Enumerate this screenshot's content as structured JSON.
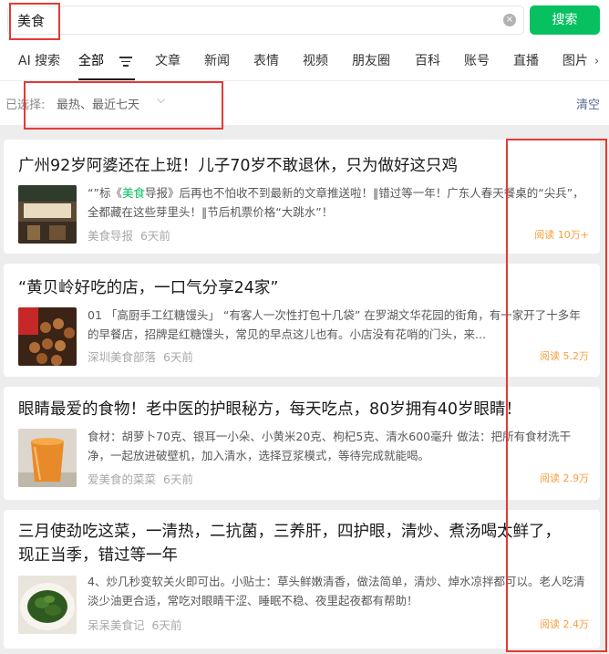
{
  "search": {
    "query": "美食",
    "clear_icon": "×",
    "button_label": "搜索"
  },
  "tabs": [
    "AI 搜索",
    "全部",
    "文章",
    "新闻",
    "表情",
    "视频",
    "朋友圈",
    "百科",
    "账号",
    "直播",
    "图片"
  ],
  "tab_more_icon": "›",
  "filter": {
    "label": "已选择:",
    "value": "最热、最近七天",
    "chevron": "⌵",
    "clear_label": "清空"
  },
  "colors": {
    "accent": "#07c160",
    "read_color": "#fa9d3b",
    "annotation_red": "#e53935"
  },
  "results": [
    {
      "title": "广州92岁阿婆还在上班！儿子70岁不敢退休，只为做好这只鸡",
      "snippet_pre": "“”标《",
      "snippet_hl": "美食",
      "snippet_post": "导报》后再也不怕收不到最新的文章推送啦！‖错过等一年！广东人春天餐桌的“尖兵”，全都藏在这些芽里头！‖节后机票价格“大跳水”！",
      "source": "美食导报",
      "time": "6天前",
      "reads": "阅读 10万+"
    },
    {
      "title": "“黄贝岭好吃的店，一口气分享24家”",
      "snippet_pre": "01 「高厨手工红糖馒头」 “有客人一次性打包十几袋” 在罗湖文华花园的街角，有一家开了十多年的早餐店，招牌是红糖馒头，常见的早点这儿也有。小店没有花哨的门头，来...",
      "snippet_hl": "",
      "snippet_post": "",
      "source": "深圳美食部落",
      "time": "6天前",
      "reads": "阅读 5.2万"
    },
    {
      "title": "眼睛最爱的食物！老中医的护眼秘方，每天吃点，80岁拥有40岁眼睛！",
      "snippet_pre": "食材：胡萝卜70克、银耳一小朵、小黄米20克、枸杞5克、清水600毫升 做法：把所有食材洗干净，一起放进破壁机，加入清水，选择豆浆模式，等待完成就能喝。",
      "snippet_hl": "",
      "snippet_post": "",
      "source": "爱美食的菜菜",
      "time": "6天前",
      "reads": "阅读 2.9万"
    },
    {
      "title_line1": "三月使劲吃这菜，一清热，二抗菌，三养肝，四护眼，清炒、煮汤喝太鲜了，",
      "title_line2": "现正当季，错过等一年",
      "snippet_pre": "4、炒几秒变软关火即可出。小贴士：草头鲜嫩清香，做法简单，清炒、焯水凉拌都可以。老人吃清淡少油更合适，常吃对眼睛干涩、睡眠不稳、夜里起夜都有帮助！",
      "snippet_hl": "",
      "snippet_post": "",
      "source": "呆呆美食记",
      "time": "6天前",
      "reads": "阅读 2.4万"
    }
  ]
}
